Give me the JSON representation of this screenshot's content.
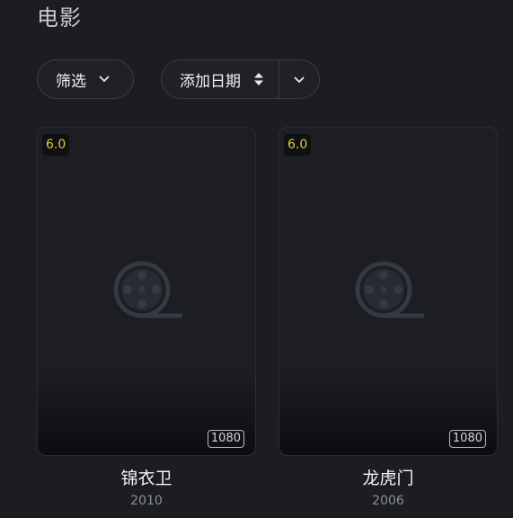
{
  "page": {
    "title": "电影"
  },
  "toolbar": {
    "filter_label": "筛选",
    "sort_label": "添加日期"
  },
  "movies": [
    {
      "title": "锦衣卫",
      "year": "2010",
      "rating": "6.0",
      "quality": "1080"
    },
    {
      "title": "龙虎门",
      "year": "2006",
      "rating": "6.0",
      "quality": "1080"
    }
  ],
  "colors": {
    "background": "#1b1d22",
    "rating": "#e5c441",
    "placeholder_icon": "#353942"
  },
  "icons": {
    "filter_chevron": "chevron-down-icon",
    "sort_order": "sort-updown-icon",
    "sort_dropdown": "chevron-down-icon",
    "poster_placeholder": "film-reel-icon"
  }
}
